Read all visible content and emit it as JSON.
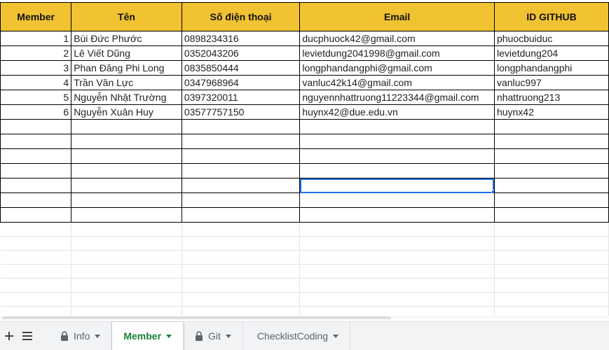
{
  "sheet": {
    "headers": [
      "Member",
      "Tên",
      "Số điện thoại",
      "Email",
      "ID GITHUB"
    ],
    "rows": [
      {
        "member": "1",
        "name": "Bùi Đức Phước",
        "phone": "0898234316",
        "email": "ducphuock42@gmail.com",
        "github": "phuocbuiduc"
      },
      {
        "member": "2",
        "name": "Lê Viết Dũng",
        "phone": "0352043206",
        "email": "levietdung2041998@gmail.com",
        "github": "levietdung204"
      },
      {
        "member": "3",
        "name": "Phan Đăng Phi Long",
        "phone": "0835850444",
        "email": "longphandangphi@gmail.com",
        "github": "longphandangphi"
      },
      {
        "member": "4",
        "name": "Trần Văn Lực",
        "phone": "0347968964",
        "email": "vanluc42k14@gmail.com",
        "github": "vanluc997"
      },
      {
        "member": "5",
        "name": "Nguyễn Nhật Trường",
        "phone": "0397320011",
        "email": "nguyennhattruong11223344@gmail.com",
        "github": "nhattruong213"
      },
      {
        "member": "6",
        "name": "Nguyễn Xuân Huy",
        "phone": "03577757150",
        "email": "huynx42@due.edu.vn",
        "github": "huynx42"
      }
    ],
    "header_color": "#f1c232",
    "selection_color": "#1a73e8"
  },
  "tabbar": {
    "add_icon": "plus-icon",
    "all_sheets_icon": "menu-icon",
    "tabs": [
      {
        "label": "Info",
        "locked": true,
        "active": false
      },
      {
        "label": "Member",
        "locked": false,
        "active": true
      },
      {
        "label": "Git",
        "locked": true,
        "active": false
      },
      {
        "label": "ChecklistCoding",
        "locked": false,
        "active": false
      }
    ],
    "active_color": "#188038"
  }
}
